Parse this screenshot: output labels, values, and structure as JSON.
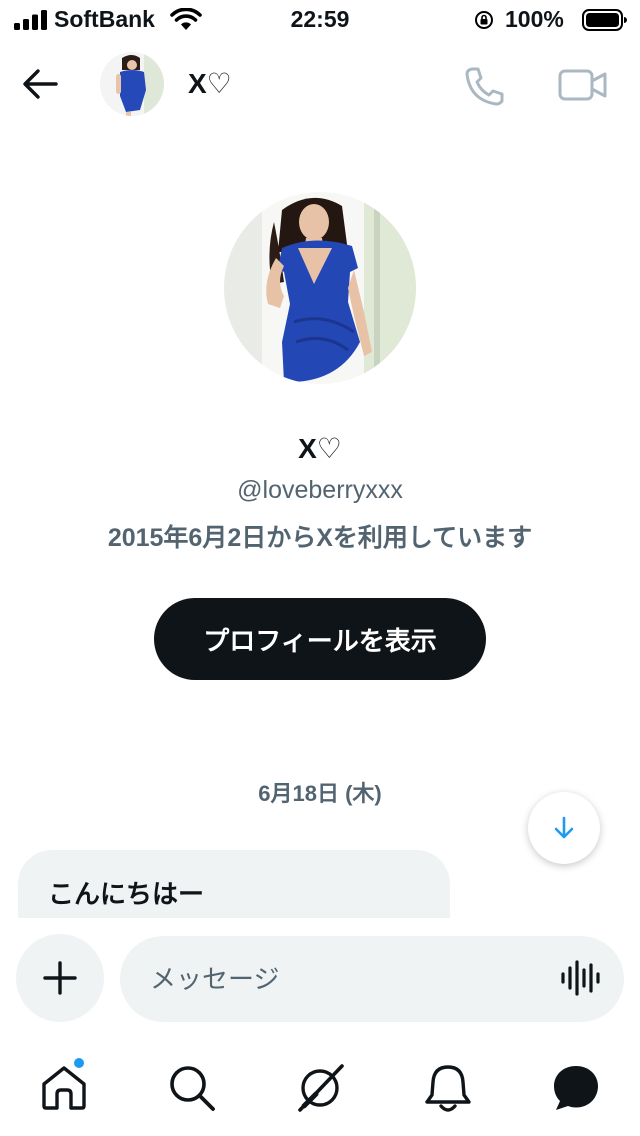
{
  "status_bar": {
    "carrier": "SoftBank",
    "time": "22:59",
    "battery": "100%"
  },
  "header": {
    "name": "X♡"
  },
  "profile": {
    "name": "X♡",
    "handle": "@loveberryxxx",
    "joined": "2015年6月2日からXを利用しています",
    "view_profile_label": "プロフィールを表示"
  },
  "conversation": {
    "date": "6月18日 (木)",
    "messages": [
      {
        "text": "こんにちはー"
      }
    ]
  },
  "composer": {
    "placeholder": "メッセージ"
  },
  "colors": {
    "accent": "#1d9bf0",
    "primary_button": "#0f1419",
    "secondary_text": "#536471",
    "bubble": "#eff3f4"
  },
  "icons": [
    "back-arrow-icon",
    "phone-icon",
    "video-icon",
    "arrow-down-icon",
    "plus-icon",
    "voice-icon",
    "home-icon",
    "search-icon",
    "grok-icon",
    "bell-icon",
    "messages-icon"
  ]
}
